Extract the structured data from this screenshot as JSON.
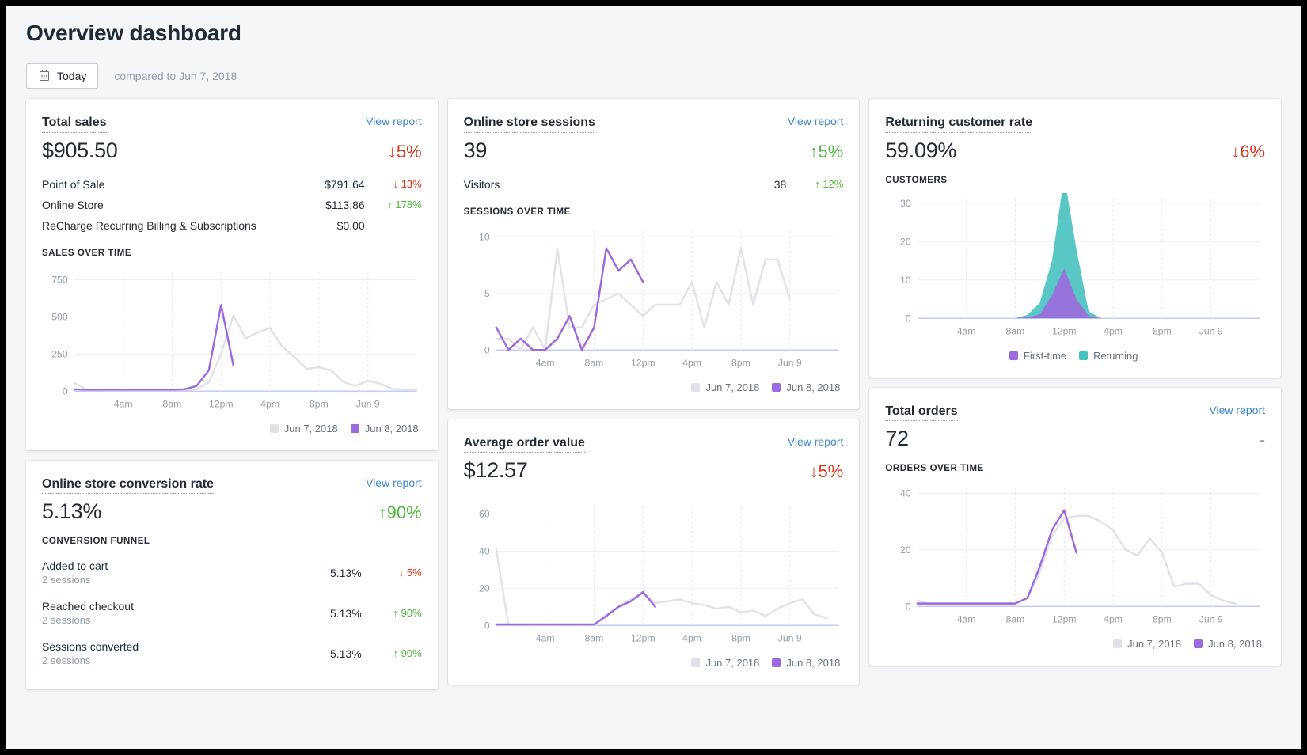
{
  "page": {
    "title": "Overview dashboard"
  },
  "daterange": {
    "button_label": "Today",
    "icon": "calendar-icon",
    "compared_text": "compared to Jun 7, 2018"
  },
  "colors": {
    "purple": "#9c6ade",
    "gray_line": "#dfe3e8",
    "teal": "#47c1bf",
    "up": "#50b83c",
    "down": "#de3618",
    "link": "#3f87d4"
  },
  "cards": {
    "total_sales": {
      "title": "Total sales",
      "view_report": "View report",
      "value": "$905.50",
      "delta": "↓5%",
      "delta_dir": "down",
      "rows": [
        {
          "label": "Point of Sale",
          "value": "$791.64",
          "delta": "↓ 13%",
          "dir": "down"
        },
        {
          "label": "Online Store",
          "value": "$113.86",
          "delta": "↑ 178%",
          "dir": "up"
        },
        {
          "label": "ReCharge Recurring Billing & Subscriptions",
          "value": "$0.00",
          "delta": "-",
          "dir": "none"
        }
      ],
      "chart_label": "SALES OVER TIME",
      "legend": [
        {
          "label": "Jun 7, 2018",
          "color": "#dfe3e8"
        },
        {
          "label": "Jun 8, 2018",
          "color": "#9c6ade"
        }
      ]
    },
    "conversion_rate": {
      "title": "Online store conversion rate",
      "view_report": "View report",
      "value": "5.13%",
      "delta": "↑90%",
      "delta_dir": "up",
      "funnel_label": "CONVERSION FUNNEL",
      "funnel": [
        {
          "name": "Added to cart",
          "sessions": "2 sessions",
          "pct": "5.13%",
          "delta": "↓ 5%",
          "dir": "down"
        },
        {
          "name": "Reached checkout",
          "sessions": "2 sessions",
          "pct": "5.13%",
          "delta": "↑ 90%",
          "dir": "up"
        },
        {
          "name": "Sessions converted",
          "sessions": "2 sessions",
          "pct": "5.13%",
          "delta": "↑ 90%",
          "dir": "up"
        }
      ]
    },
    "sessions": {
      "title": "Online store sessions",
      "view_report": "View report",
      "value": "39",
      "delta": "↑5%",
      "delta_dir": "up",
      "rows": [
        {
          "label": "Visitors",
          "value": "38",
          "delta": "↑ 12%",
          "dir": "up"
        }
      ],
      "chart_label": "SESSIONS OVER TIME",
      "legend": [
        {
          "label": "Jun 7, 2018",
          "color": "#dfe3e8"
        },
        {
          "label": "Jun 8, 2018",
          "color": "#9c6ade"
        }
      ]
    },
    "aov": {
      "title": "Average order value",
      "view_report": "View report",
      "value": "$12.57",
      "delta": "↓5%",
      "delta_dir": "down",
      "legend": [
        {
          "label": "Jun 7, 2018",
          "color": "#dfe3e8"
        },
        {
          "label": "Jun 8, 2018",
          "color": "#9c6ade"
        }
      ]
    },
    "returning_rate": {
      "title": "Returning customer rate",
      "value": "59.09%",
      "delta": "↓6%",
      "delta_dir": "down",
      "chart_label": "CUSTOMERS",
      "legend": [
        {
          "label": "First-time",
          "color": "#9c6ade"
        },
        {
          "label": "Returning",
          "color": "#47c1bf"
        }
      ]
    },
    "total_orders": {
      "title": "Total orders",
      "view_report": "View report",
      "value": "72",
      "delta": "-",
      "delta_dir": "none",
      "chart_label": "ORDERS OVER TIME",
      "legend": [
        {
          "label": "Jun 7, 2018",
          "color": "#dfe3e8"
        },
        {
          "label": "Jun 8, 2018",
          "color": "#9c6ade"
        }
      ]
    }
  },
  "chart_data": [
    {
      "id": "sales_over_time",
      "type": "line",
      "title": "SALES OVER TIME",
      "xlabel": "",
      "ylabel": "",
      "grid": true,
      "legend_position": "bottom-right",
      "xticks": [
        "4am",
        "8am",
        "12pm",
        "4pm",
        "8pm",
        "Jun 9"
      ],
      "yticks": [
        0,
        250,
        500,
        750
      ],
      "ylim": [
        0,
        800
      ],
      "series": [
        {
          "name": "Jun 7, 2018",
          "color": "#dfe3e8",
          "values": [
            55,
            10,
            8,
            8,
            8,
            8,
            8,
            8,
            8,
            8,
            12,
            60,
            250,
            510,
            355,
            395,
            425,
            300,
            230,
            150,
            160,
            140,
            60,
            35,
            70,
            50,
            15,
            10,
            8
          ]
        },
        {
          "name": "Jun 8, 2018",
          "color": "#9c6ade",
          "values": [
            12,
            10,
            10,
            10,
            10,
            10,
            10,
            10,
            10,
            12,
            35,
            140,
            580,
            175
          ]
        }
      ]
    },
    {
      "id": "sessions_over_time",
      "type": "line",
      "title": "SESSIONS OVER TIME",
      "xlabel": "",
      "ylabel": "",
      "grid": true,
      "legend_position": "bottom-right",
      "xticks": [
        "4am",
        "8am",
        "12pm",
        "4pm",
        "8pm",
        "Jun 9"
      ],
      "yticks": [
        0,
        5,
        10
      ],
      "ylim": [
        0,
        10.5
      ],
      "series": [
        {
          "name": "Jun 7, 2018",
          "color": "#dfe3e8",
          "values": [
            1,
            1,
            0,
            2,
            0,
            9,
            2,
            2,
            4,
            4.5,
            5,
            4,
            3,
            4,
            4,
            4,
            6,
            2,
            6,
            4,
            9,
            4,
            8,
            8,
            4.5
          ]
        },
        {
          "name": "Jun 8, 2018",
          "color": "#9c6ade",
          "values": [
            2,
            0,
            1,
            0,
            0,
            1,
            3,
            0,
            2,
            9,
            7,
            8,
            6
          ]
        }
      ]
    },
    {
      "id": "average_order_value",
      "type": "line",
      "title": "",
      "xlabel": "",
      "ylabel": "",
      "grid": true,
      "legend_position": "bottom-right",
      "xticks": [
        "4am",
        "8am",
        "12pm",
        "4pm",
        "8pm",
        "Jun 9"
      ],
      "yticks": [
        0,
        20,
        40,
        60
      ],
      "ylim": [
        0,
        64
      ],
      "series": [
        {
          "name": "Jun 7, 2018",
          "color": "#dfe3e8",
          "values": [
            41,
            0,
            0,
            0,
            0,
            0,
            0,
            0,
            0,
            6,
            10,
            14,
            17,
            12,
            13,
            14,
            12,
            11,
            9,
            10,
            7,
            8,
            5,
            9,
            12,
            14,
            6,
            4
          ]
        },
        {
          "name": "Jun 8, 2018",
          "color": "#9c6ade",
          "values": [
            0.5,
            0.5,
            0.5,
            0.5,
            0.5,
            0.5,
            0.5,
            0.5,
            0.5,
            5,
            10,
            13,
            18,
            10
          ]
        }
      ]
    },
    {
      "id": "customers",
      "type": "area",
      "title": "CUSTOMERS",
      "xlabel": "",
      "ylabel": "",
      "grid": true,
      "stacked": true,
      "legend_position": "bottom-center",
      "xticks": [
        "4am",
        "8am",
        "12pm",
        "4pm",
        "8pm",
        "Jun 9"
      ],
      "yticks": [
        0,
        10,
        20,
        30
      ],
      "ylim": [
        0,
        31
      ],
      "series": [
        {
          "name": "First-time",
          "color": "#9c6ade",
          "values": [
            0,
            0,
            0,
            0,
            0,
            0,
            0,
            0,
            0,
            0.3,
            1,
            6,
            13,
            5,
            0.6,
            0,
            0,
            0,
            0,
            0,
            0,
            0,
            0,
            0,
            0
          ]
        },
        {
          "name": "Returning",
          "color": "#47c1bf",
          "values": [
            0,
            0,
            0,
            0,
            0,
            0,
            0,
            0,
            0,
            0.6,
            3,
            9,
            24,
            13,
            1.2,
            0,
            0,
            0,
            0,
            0,
            0,
            0,
            0,
            0,
            0
          ]
        }
      ]
    },
    {
      "id": "orders_over_time",
      "type": "line",
      "title": "ORDERS OVER TIME",
      "xlabel": "",
      "ylabel": "",
      "grid": true,
      "legend_position": "bottom-right",
      "xticks": [
        "4am",
        "8am",
        "12pm",
        "4pm",
        "8pm",
        "Jun 9"
      ],
      "yticks": [
        0,
        20,
        40
      ],
      "ylim": [
        0,
        42
      ],
      "series": [
        {
          "name": "Jun 7, 2018",
          "color": "#dfe3e8",
          "values": [
            2,
            1,
            1,
            1,
            1,
            1,
            1,
            1,
            1,
            3,
            12,
            25,
            31,
            32,
            32,
            30,
            27,
            20,
            18,
            24,
            19,
            7,
            8,
            8,
            4,
            2,
            1
          ]
        },
        {
          "name": "Jun 8, 2018",
          "color": "#9c6ade",
          "values": [
            1,
            1,
            1,
            1,
            1,
            1,
            1,
            1,
            1,
            3,
            14,
            27,
            34,
            19
          ]
        }
      ]
    }
  ]
}
